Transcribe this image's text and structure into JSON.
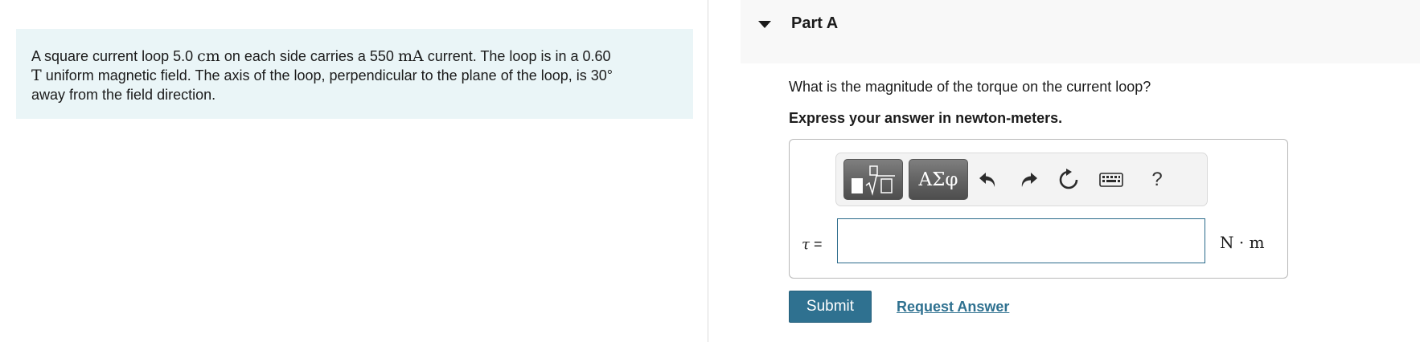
{
  "problem": {
    "text_1": "A square current loop 5.0 ",
    "unit_cm": "cm",
    "text_2": " on each side carries a 550 ",
    "unit_mA": "mA",
    "text_3": " current. The loop is in a 0.60",
    "unit_T": "T",
    "text_4": " uniform magnetic field. The axis of the loop, perpendicular to the plane of the loop, is 30°",
    "text_5": "away from the field direction."
  },
  "part": {
    "title": "Part A"
  },
  "question": "What is the magnitude of the torque on the current loop?",
  "instruction": "Express your answer in newton-meters.",
  "toolbar": {
    "symbols_label": "ΑΣφ",
    "help_label": "?",
    "icons": [
      "templates-icon",
      "undo-icon",
      "redo-icon",
      "reset-icon",
      "keyboard-icon",
      "help-icon"
    ]
  },
  "answer": {
    "variable": "τ",
    "equals": " =",
    "value": "",
    "unit": "N · m"
  },
  "actions": {
    "submit_label": "Submit",
    "request_answer_label": "Request Answer"
  },
  "colors": {
    "problem_bg": "#eaf5f7",
    "accent": "#2f7190",
    "toolbar_button": "#666666"
  }
}
